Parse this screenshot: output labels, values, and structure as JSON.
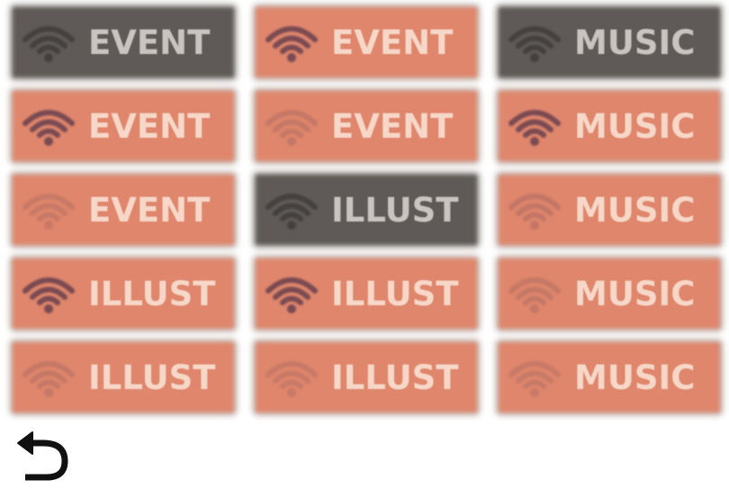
{
  "tiles": [
    {
      "label": "EVENT",
      "theme": "dark",
      "signal_strength": 1.0,
      "col": 0,
      "row": 0
    },
    {
      "label": "EVENT",
      "theme": "orange",
      "signal_strength": 1.0,
      "col": 1,
      "row": 0
    },
    {
      "label": "MUSIC",
      "theme": "dark",
      "signal_strength": 1.0,
      "col": 2,
      "row": 0
    },
    {
      "label": "EVENT",
      "theme": "orange",
      "signal_strength": 1.0,
      "col": 0,
      "row": 1
    },
    {
      "label": "EVENT",
      "theme": "orange",
      "signal_strength": 0.6,
      "col": 1,
      "row": 1
    },
    {
      "label": "MUSIC",
      "theme": "orange",
      "signal_strength": 1.0,
      "col": 2,
      "row": 1
    },
    {
      "label": "EVENT",
      "theme": "orange",
      "signal_strength": 0.4,
      "col": 0,
      "row": 2
    },
    {
      "label": "ILLUST",
      "theme": "dark",
      "signal_strength": 1.0,
      "col": 1,
      "row": 2
    },
    {
      "label": "MUSIC",
      "theme": "orange",
      "signal_strength": 0.8,
      "col": 2,
      "row": 2
    },
    {
      "label": "ILLUST",
      "theme": "orange",
      "signal_strength": 1.0,
      "col": 0,
      "row": 3
    },
    {
      "label": "ILLUST",
      "theme": "orange",
      "signal_strength": 1.0,
      "col": 1,
      "row": 3
    },
    {
      "label": "MUSIC",
      "theme": "orange",
      "signal_strength": 0.6,
      "col": 2,
      "row": 3
    },
    {
      "label": "ILLUST",
      "theme": "orange",
      "signal_strength": 0.6,
      "col": 0,
      "row": 4
    },
    {
      "label": "ILLUST",
      "theme": "orange",
      "signal_strength": 0.4,
      "col": 1,
      "row": 4
    },
    {
      "label": "MUSIC",
      "theme": "orange",
      "signal_strength": 0.4,
      "col": 2,
      "row": 4
    }
  ],
  "colors": {
    "orange": "#df866c",
    "dark": "#5f5a57",
    "wifi_strong": "#7a4a52",
    "wifi_weak": "#c07565",
    "wifi_dark": "#403c3a",
    "back_icon": "#111111"
  },
  "back_button": {
    "icon": "back-arrow-icon"
  }
}
